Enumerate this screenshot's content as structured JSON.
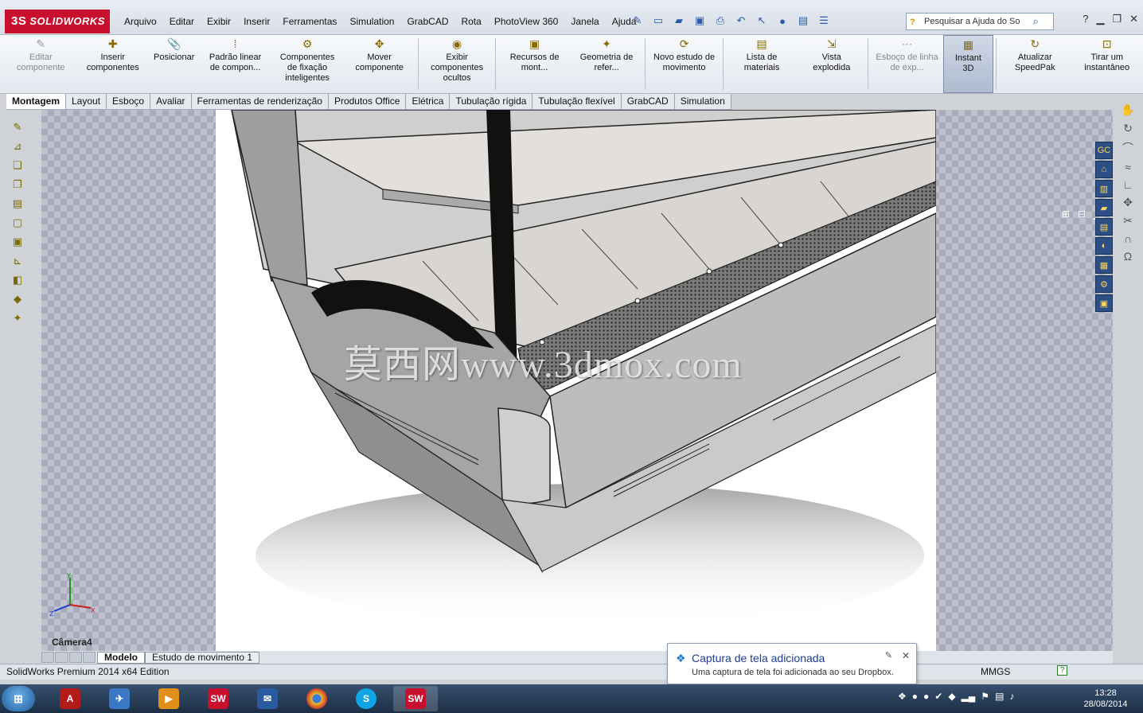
{
  "app": {
    "logo_prefix": "3S",
    "logo_text": "SOLIDWORKS"
  },
  "menu": [
    "Arquivo",
    "Editar",
    "Exibir",
    "Inserir",
    "Ferramentas",
    "Simulation",
    "GrabCAD",
    "Rota",
    "PhotoView 360",
    "Janela",
    "Ajuda"
  ],
  "search": {
    "placeholder": "Pesquisar a Ajuda do So"
  },
  "ribbon": [
    {
      "label": "Editar componente",
      "icon": "edit-component-icon",
      "disabled": true
    },
    {
      "label": "Inserir componentes",
      "icon": "insert-components-icon"
    },
    {
      "label": "Posicionar",
      "icon": "mate-icon"
    },
    {
      "label": "Padrão linear de compon...",
      "icon": "linear-pattern-icon"
    },
    {
      "label": "Componentes de fixação inteligentes",
      "icon": "smart-fasteners-icon"
    },
    {
      "label": "Mover componente",
      "icon": "move-component-icon"
    },
    {
      "label": "Exibir componentes ocultos",
      "icon": "show-hidden-icon"
    },
    {
      "label": "Recursos de mont...",
      "icon": "assembly-features-icon"
    },
    {
      "label": "Geometria de refer...",
      "icon": "reference-geometry-icon"
    },
    {
      "label": "Novo estudo de movimento",
      "icon": "motion-study-icon"
    },
    {
      "label": "Lista de materiais",
      "icon": "bom-icon"
    },
    {
      "label": "Vista explodida",
      "icon": "exploded-view-icon"
    },
    {
      "label": "Esboço de linha de exp...",
      "icon": "explode-line-icon",
      "disabled": true
    },
    {
      "label": "Instant 3D",
      "icon": "instant3d-icon",
      "active": true
    },
    {
      "label": "Atualizar SpeedPak",
      "icon": "speedpak-icon"
    },
    {
      "label": "Tirar um instantâneo",
      "icon": "snapshot-icon"
    }
  ],
  "tabs": [
    "Montagem",
    "Layout",
    "Esboço",
    "Avaliar",
    "Ferramentas de renderização",
    "Produtos Office",
    "Elétrica",
    "Tubulação rígida",
    "Tubulação flexível",
    "GrabCAD",
    "Simulation"
  ],
  "viewport": {
    "camera_label": "Câmera4",
    "watermark": "莫西网www.3dmox.com"
  },
  "bottom_tabs": [
    "Modelo",
    "Estudo de movimento 1"
  ],
  "status": {
    "edition": "SolidWorks Premium 2014 x64 Edition",
    "units": "MMGS"
  },
  "notification": {
    "title": "Captura de tela adicionada",
    "message": "Uma captura de tela foi adicionada ao seu Dropbox."
  },
  "clock": {
    "time": "13:28",
    "date": "28/08/2014"
  },
  "colors": {
    "brand_red": "#c8102e",
    "viewport_check": "#a9abbd"
  }
}
